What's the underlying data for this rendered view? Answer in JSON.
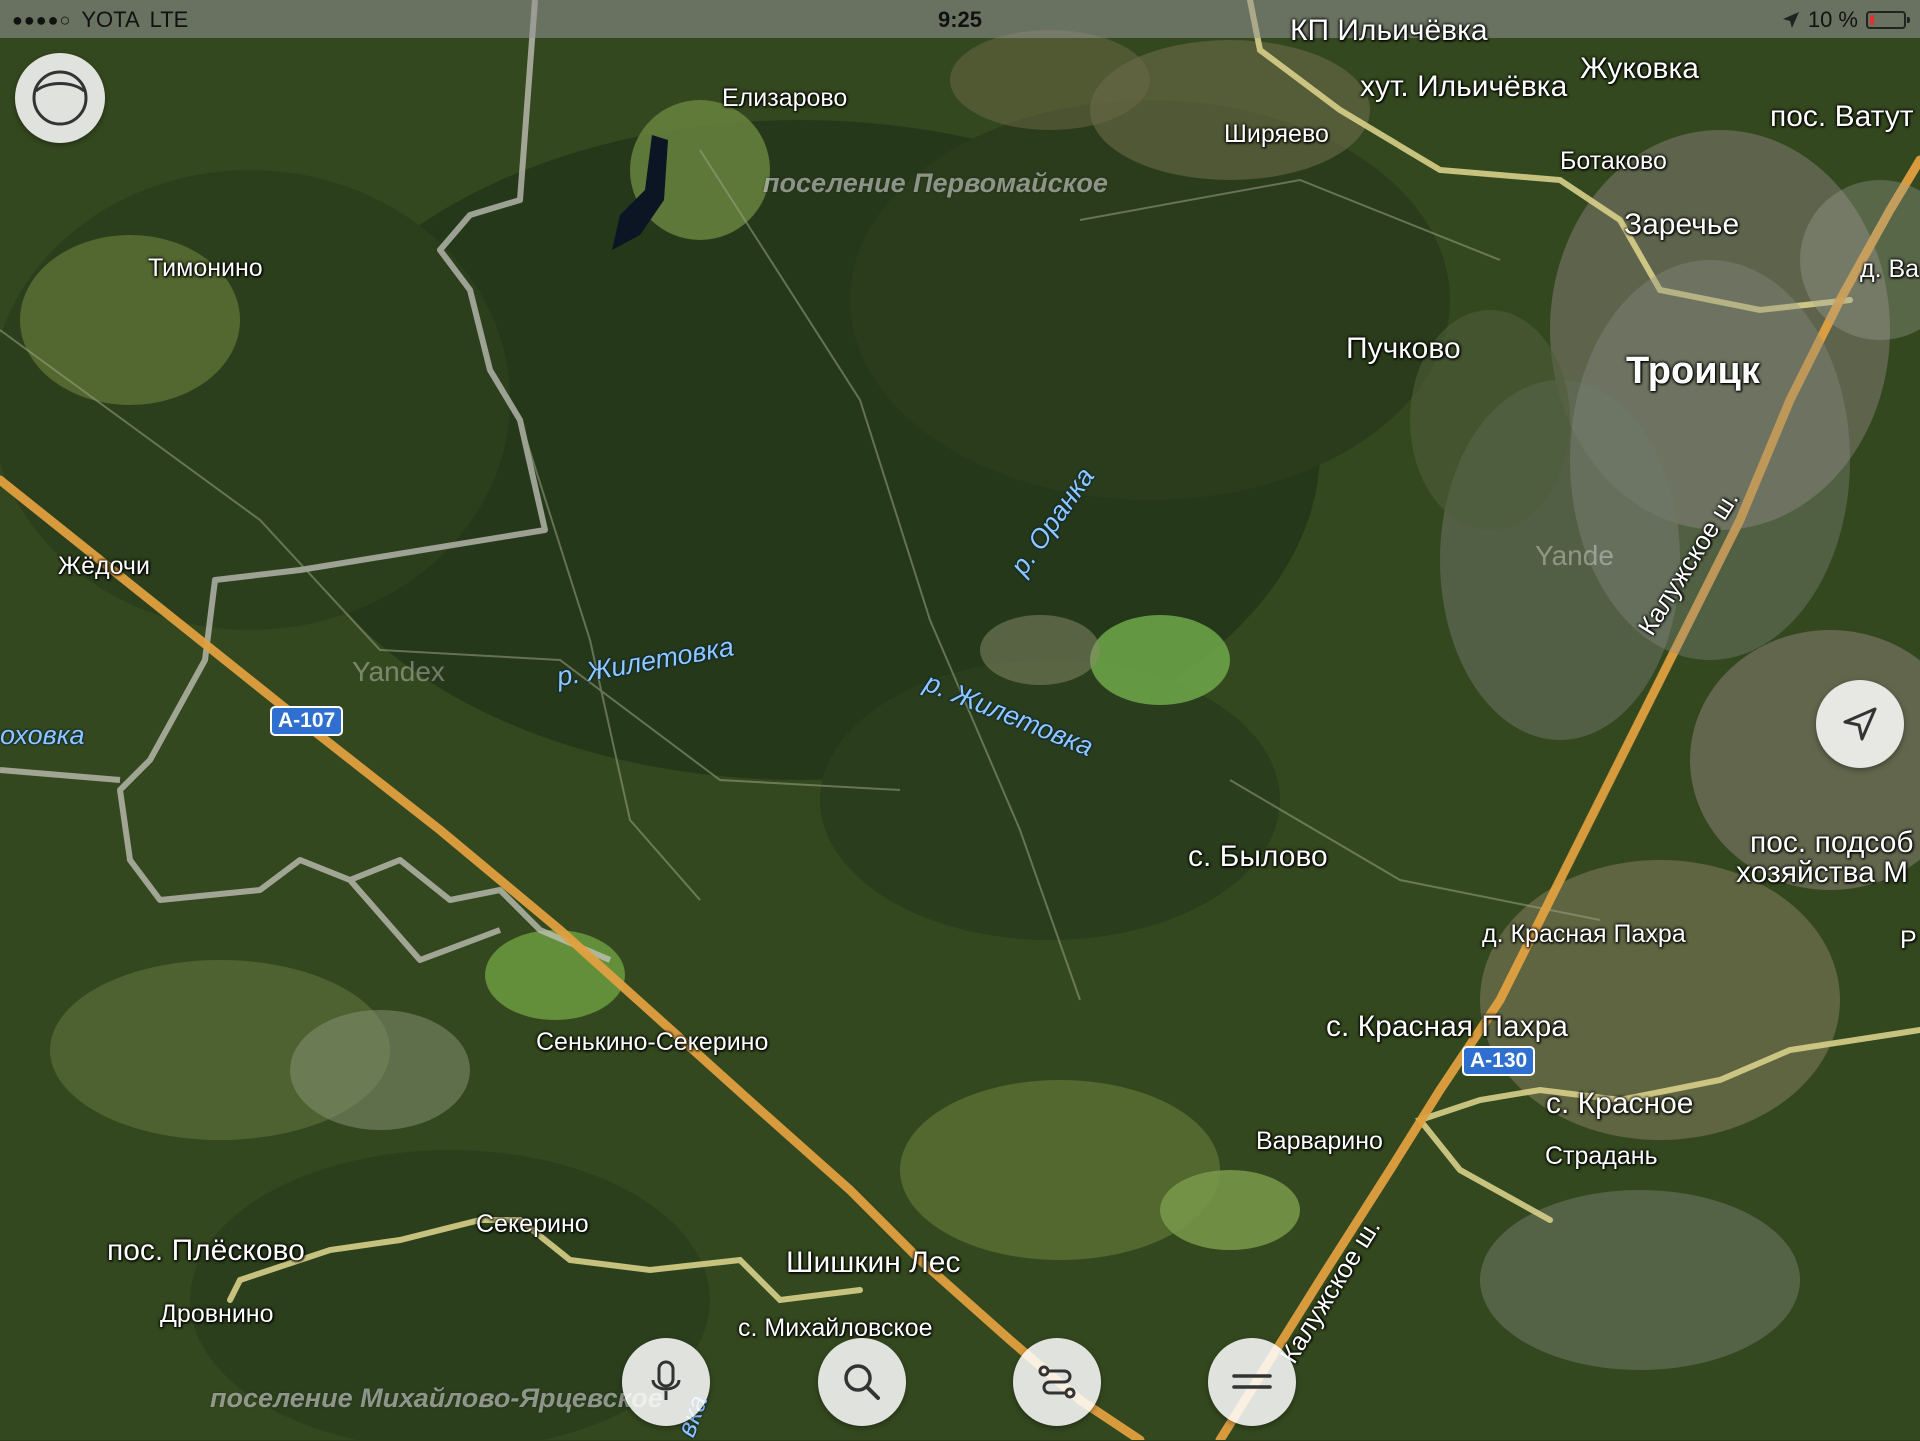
{
  "status_bar": {
    "carrier": "YOTA",
    "network": "LTE",
    "time": "9:25",
    "battery": "10 %",
    "signal_dots": "●●●●○"
  },
  "map": {
    "settlements": {
      "kp_ilichevka": "КП Ильичёвка",
      "khut_ilichevka": "хут. Ильичёвка",
      "zhukovka": "Жуковка",
      "pos_vatutinki": "пос. Ватут",
      "elizarovo": "Елизарово",
      "shiryaevo": "Ширяево",
      "botakovo": "Ботаково",
      "zarechye": "Заречье",
      "d_vatutinki": "д. Ва",
      "timonino": "Тимонино",
      "puchkovo": "Пучково",
      "troitsk": "Троицк",
      "zhedochi": "Жёдочи",
      "s_bylovo": "с. Былово",
      "pos_podsob": "пос. подсоб",
      "khozyaystva": "хозяйства М",
      "d_krasnaya_pakhra": "д. Красная Пахра",
      "r_edge": "Р",
      "s_krasnaya_pakhra": "с. Красная Пахра",
      "senkino": "Сенькино-Секерино",
      "s_krasnoe": "с. Красное",
      "varvarino": "Варварино",
      "stradan": "Страдань",
      "sekerino": "Секерино",
      "pos_pleskovo": "пос. Плёсково",
      "shishkin_les": "Шишкин Лес",
      "drovnino": "Дровнино",
      "s_mikhaylovskoe": "с. Михайловское"
    },
    "areas": {
      "pervomayskoe": "поселение Первомайское",
      "mikhaylovo": "поселение Михайлово-Ярцевское"
    },
    "rivers": {
      "oranka": "р. Оранка",
      "zhiletovka_1": "р. Жилетовка",
      "zhiletovka_2": "р. Жилетовка",
      "west_river": "оховка",
      "bottom_river": "вка"
    },
    "roads": {
      "kaluzhskoe_1": "Калужское ш.",
      "kaluzhskoe_2": "Калужское ш."
    },
    "shields": {
      "a107": "А-107",
      "a130": "А-130"
    },
    "watermarks": {
      "yandex_1": "Yandex",
      "yandex_2": "Yande"
    }
  },
  "controls": {
    "layers_button": "layers-icon",
    "locate_button": "location-arrow-icon",
    "voice_button": "microphone-icon",
    "search_button": "search-icon",
    "routes_button": "route-icon",
    "menu_button": "menu-icon"
  },
  "colors": {
    "forest": "#2f4420",
    "field": "#5f7a38",
    "highway": "#e0a040",
    "local_road": "#d8cf8a",
    "boundary": "#c9c9c9",
    "shield": "#2f6fcf"
  }
}
